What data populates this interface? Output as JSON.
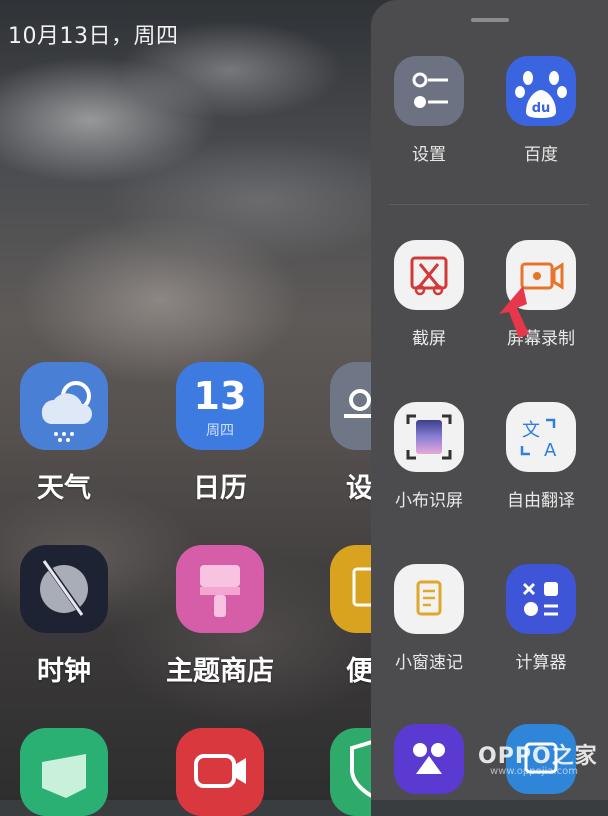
{
  "status": {
    "date": "10月13日，周四"
  },
  "home_apps": [
    {
      "label": "天气",
      "icon": "weather-icon",
      "color": "#4a7fd6"
    },
    {
      "label": "日历",
      "icon": "calendar-icon",
      "color": "#3e7be0",
      "day": "13",
      "weekday": "周四"
    },
    {
      "label": "设",
      "icon": "settings-icon",
      "color": "#6f7686"
    },
    {
      "label": "时钟",
      "icon": "clock-icon",
      "color": "#1e2333"
    },
    {
      "label": "主题商店",
      "icon": "theme-store-icon",
      "color": "#d65ea8"
    },
    {
      "label": "便",
      "icon": "notes-icon",
      "color": "#d9a320"
    }
  ],
  "bottom_apps": [
    {
      "icon": "gallery-icon",
      "color": "#2bb074"
    },
    {
      "icon": "video-icon",
      "color": "#d8383e"
    },
    {
      "icon": "security-icon",
      "color": "#2eaa6a"
    }
  ],
  "panel": {
    "tiles": [
      {
        "label": "设置",
        "icon": "settings-icon",
        "color": "#6c7282"
      },
      {
        "label": "百度",
        "icon": "baidu-icon",
        "color": "#3b64e0"
      },
      {
        "label": "截屏",
        "icon": "screenshot-icon",
        "color": "#f2f2f2"
      },
      {
        "label": "屏幕录制",
        "icon": "screen-record-icon",
        "color": "#f2f2f2"
      },
      {
        "label": "小布识屏",
        "icon": "screen-recognition-icon",
        "color": "#f2f2f2"
      },
      {
        "label": "自由翻译",
        "icon": "translate-icon",
        "color": "#f2f2f2"
      },
      {
        "label": "小窗速记",
        "icon": "quick-note-icon",
        "color": "#f2f2f2"
      },
      {
        "label": "计算器",
        "icon": "calculator-icon",
        "color": "#3e55d8"
      }
    ]
  },
  "watermark": {
    "brand": "OPPO之家",
    "url": "www.oppojia.com"
  }
}
